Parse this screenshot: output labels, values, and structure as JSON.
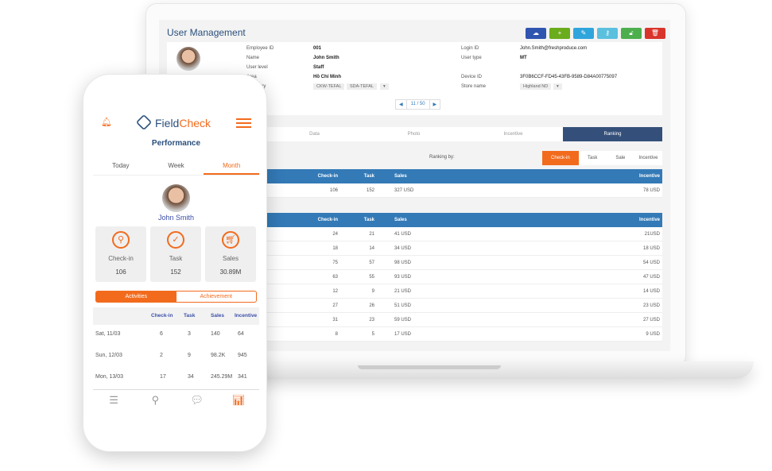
{
  "laptop": {
    "title": "User Management",
    "toolbar": [
      {
        "icon": "cloud-upload-icon",
        "color": "#2f55b0"
      },
      {
        "icon": "plus-icon",
        "color": "#6aac1c"
      },
      {
        "icon": "edit-icon",
        "color": "#2fa5dc"
      },
      {
        "icon": "key-icon",
        "color": "#5bc0de"
      },
      {
        "icon": "unlock-icon",
        "color": "#4cae4c"
      },
      {
        "icon": "trash-icon",
        "color": "#d9342b"
      }
    ],
    "profile": {
      "employee_id_label": "Employee ID",
      "employee_id": "001",
      "name_label": "Name",
      "name": "John Smith",
      "user_level_label": "User level",
      "user_level": "Staff",
      "area_label": "Area",
      "area": "Hồ Chí Minh",
      "category_label": "Category",
      "categories": [
        "CKW-TEFAL",
        "SDA-TEFAL"
      ],
      "login_id_label": "Login ID",
      "login_id": "John.Smith@freshproduce.com",
      "user_type_label": "User type",
      "user_type": "MT",
      "device_id_label": "Device ID",
      "device_id": "3F0B6CCF-FD45-43FB-9589-D84A00775097",
      "store_name_label": "Store name",
      "store_name": "Highland ND"
    },
    "pager": "11 / 50",
    "tabs": [
      "Data",
      "Photo",
      "Incentive",
      "Ranking"
    ],
    "active_tab": "Ranking",
    "ranking_by_label": "Ranking by:",
    "ranking_options": [
      "Check-in",
      "Task",
      "Sale",
      "Incentive"
    ],
    "active_ranking": "Check-in",
    "columns": [
      "Check-in",
      "Task",
      "Sales",
      "Incentive"
    ],
    "summary_row": [
      "106",
      "152",
      "327 USD",
      "78 USD"
    ],
    "rows": [
      [
        "24",
        "21",
        "41 USD",
        "21USD"
      ],
      [
        "18",
        "14",
        "34 USD",
        "18 USD"
      ],
      [
        "75",
        "57",
        "98 USD",
        "54 USD"
      ],
      [
        "63",
        "55",
        "93 USD",
        "47 USD"
      ],
      [
        "12",
        "9",
        "21 USD",
        "14 USD"
      ],
      [
        "27",
        "26",
        "51 USD",
        "23 USD"
      ],
      [
        "31",
        "23",
        "59 USD",
        "27 USD"
      ],
      [
        "8",
        "5",
        "17 USD",
        "9 USD"
      ]
    ],
    "colors": {
      "header": "#337ab7",
      "active_tab": "#34507a",
      "accent": "#f26b1d"
    }
  },
  "phone": {
    "brand_a": "Field",
    "brand_b": "Check",
    "title": "Performance",
    "tabs": [
      "Today",
      "Week",
      "Month"
    ],
    "active_tab": "Month",
    "user": "John Smith",
    "stats": [
      {
        "label": "Check-in",
        "value": "106",
        "icon": "map-pin-icon"
      },
      {
        "label": "Task",
        "value": "152",
        "icon": "check-icon"
      },
      {
        "label": "Sales",
        "value": "30.89M",
        "icon": "cart-icon"
      }
    ],
    "toggle": [
      "Activities",
      "Achievement"
    ],
    "columns": [
      "Check-in",
      "Task",
      "Sales",
      "Incentive"
    ],
    "rows": [
      [
        "Sat, 11/03",
        "6",
        "3",
        "140",
        "64"
      ],
      [
        "Sun, 12/03",
        "2",
        "9",
        "98.2K",
        "945"
      ],
      [
        "Mon, 13/03",
        "17",
        "34",
        "245.29M",
        "341"
      ]
    ],
    "nav": [
      "list-icon",
      "map-icon",
      "chat-icon",
      "chart-icon"
    ]
  }
}
